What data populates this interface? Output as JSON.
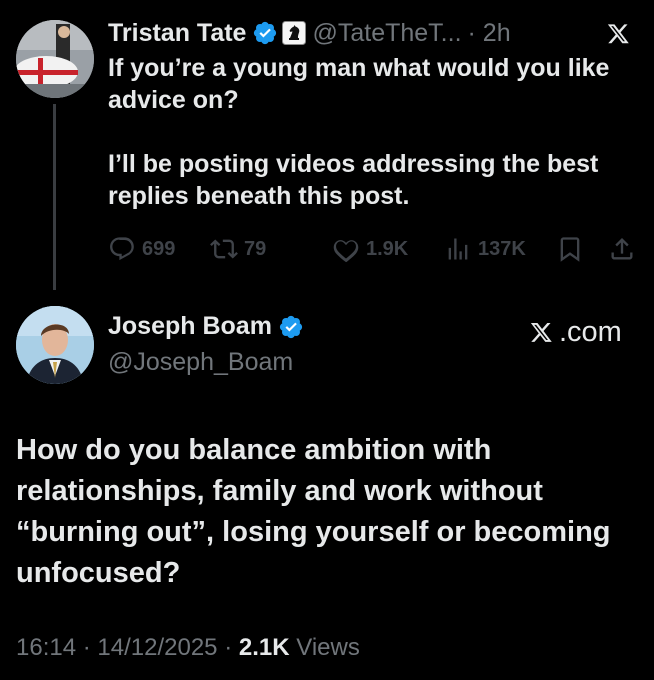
{
  "tweet1": {
    "author_name": "Tristan Tate",
    "handle": "@TateTheT...",
    "time_ago": "· 2h",
    "text_p1": "If you’re a young man what would you like advice on?",
    "text_p2": "I’ll be posting videos addressing the best replies beneath this post.",
    "stats": {
      "replies": "699",
      "reposts": "79",
      "likes": "1.9K",
      "views": "137K"
    },
    "icons": {
      "verified": "verified-badge-icon",
      "affiliate": "chess-knight-icon",
      "logo": "x-logo-icon",
      "reply": "reply-icon",
      "repost": "repost-icon",
      "like": "heart-icon",
      "views": "views-chart-icon",
      "bookmark": "bookmark-icon",
      "share": "share-icon"
    }
  },
  "tweet2": {
    "author_name": "Joseph Boam",
    "handle": "@Joseph_Boam",
    "brand": ".com",
    "text": "How do you balance ambition with relationships, family and work without “burning out”, losing yourself or becoming unfocused?",
    "time": "16:14",
    "date": "14/12/2025",
    "views_count": "2.1K",
    "views_label": "Views"
  },
  "colors": {
    "background": "#000000",
    "text_primary": "#e7e9ea",
    "text_secondary": "#71767b",
    "verified_blue": "#1d9bf0",
    "action_icons": "#3f4349"
  }
}
